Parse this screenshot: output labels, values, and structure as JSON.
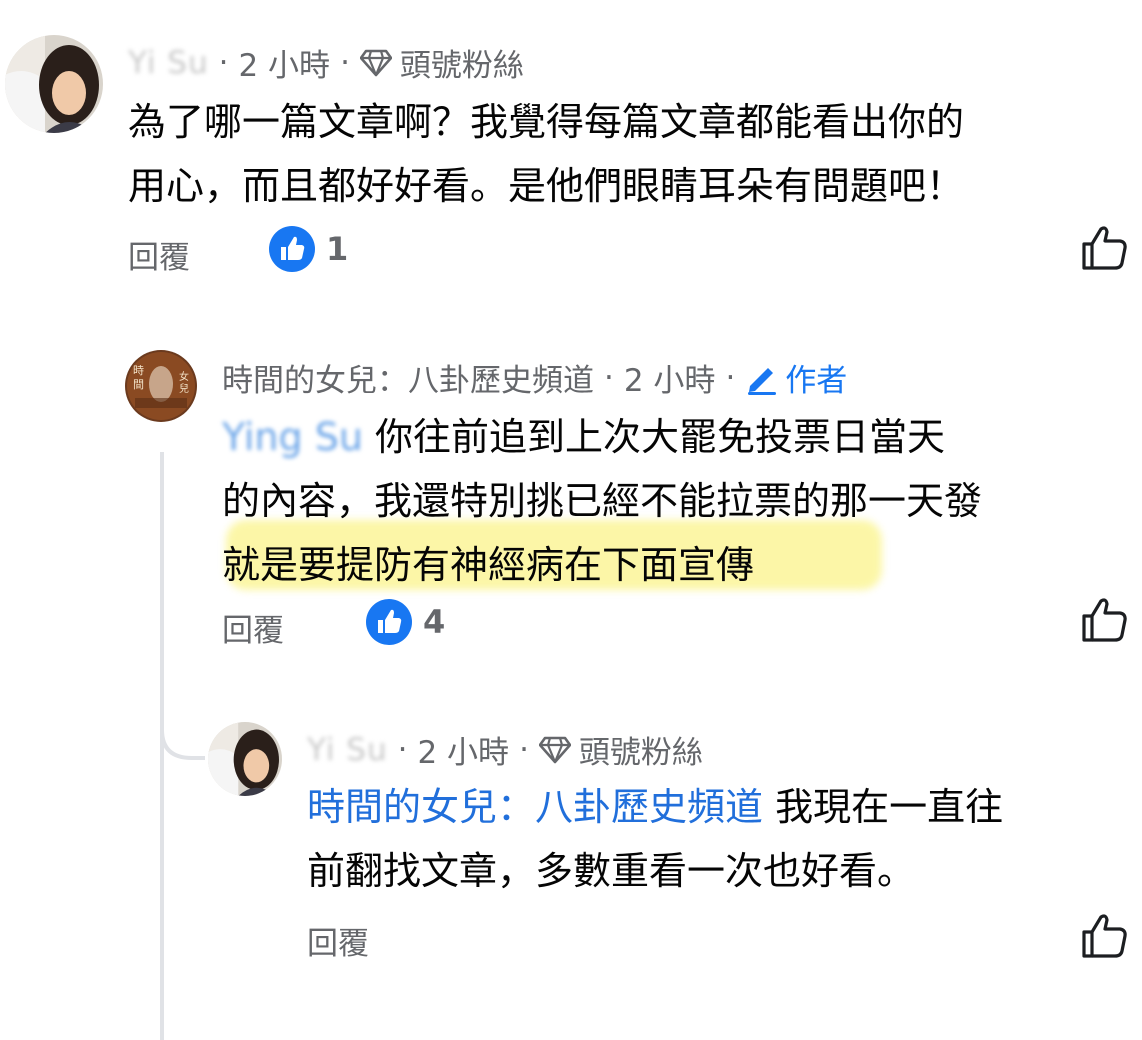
{
  "comment1": {
    "author": "Yi     Su",
    "time": "2 小時",
    "badge": "頭號粉絲",
    "text_line1": "為了哪一篇文章啊？我覺得每篇文章都能看出你的",
    "text_line2": "用心，而且都好好看。是他們眼睛耳朵有問題吧！",
    "reply_label": "回覆",
    "like_count": "1"
  },
  "comment2": {
    "author": "時間的女兒：八卦歷史頻道",
    "time": "2 小時",
    "author_tag": "作者",
    "avatar_text": "時間的女兒",
    "mention": "Ying   Su",
    "text_line1": "你往前追到上次大罷免投票日當天",
    "text_line2": "的內容，我還特別挑已經不能拉票的那一天發",
    "text_line3": "就是要提防有神經病在下面宣傳",
    "reply_label": "回覆",
    "like_count": "4"
  },
  "comment3": {
    "author": "Yi     Su",
    "time": "2 小時",
    "badge": "頭號粉絲",
    "mention": "時間的女兒：八卦歷史頻道",
    "text_line1": "我現在一直往",
    "text_line2": "前翻找文章，多數重看一次也好看。",
    "reply_label": "回覆"
  },
  "colors": {
    "like_blue": "#1877f2",
    "mention_blue": "#216fdb",
    "highlight": "#fbf48a",
    "meta_gray": "#65676b"
  },
  "icons": [
    "avatar-photo",
    "diamond-icon",
    "pencil-icon",
    "like-reaction-icon",
    "thumbs-up-icon"
  ]
}
